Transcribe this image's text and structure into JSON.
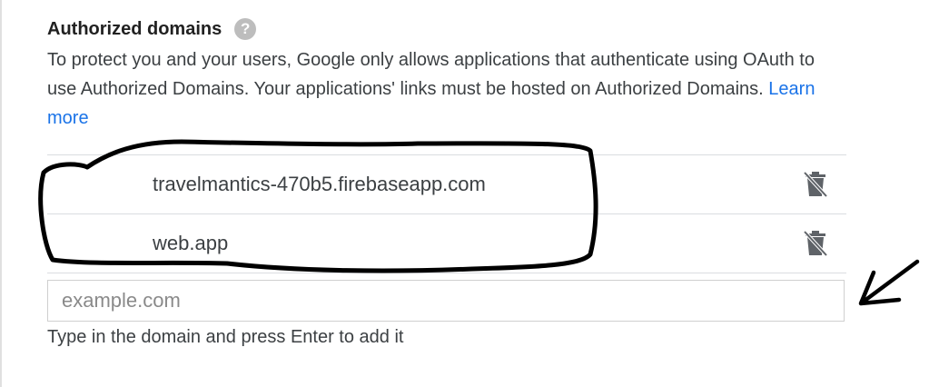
{
  "section": {
    "title": "Authorized domains",
    "help_icon": "question-mark-icon",
    "description": "To protect you and your users, Google only allows applications that authenticate using OAuth to use Authorized Domains. Your applications' links must be hosted on Authorized Domains.",
    "learn_more": "Learn more"
  },
  "domains": [
    {
      "name": "travelmantics-470b5.firebaseapp.com",
      "delete_icon": "trash-icon"
    },
    {
      "name": "web.app",
      "delete_icon": "trash-icon"
    }
  ],
  "new_domain": {
    "value": "",
    "placeholder": "example.com",
    "hint": "Type in the domain and press Enter to add it"
  },
  "colors": {
    "link": "#1a73e8",
    "text": "#3c4043",
    "divider": "#dadce0",
    "annotation": "#000000"
  }
}
